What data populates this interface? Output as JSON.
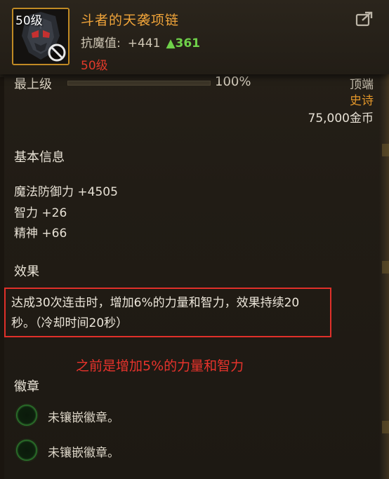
{
  "header": {
    "level_badge": "50级",
    "item_name": "斗者的天袭项链",
    "stat_label": "抗魔值:",
    "stat_value": "+441",
    "stat_up_arrow": "▲",
    "stat_up_value": "361",
    "required_level": "50级",
    "icons": {
      "item": "necklace-item-icon",
      "ban": "ban-icon",
      "share": "share-link-icon"
    }
  },
  "partial_row": {
    "label": "最上级",
    "percent": "100%",
    "right_text": "顶端"
  },
  "rarity": "史诗",
  "price": "75,000金币",
  "basic_info": {
    "title": "基本信息",
    "stats": [
      "魔法防御力 +4505",
      "智力 +26",
      "精神 +66"
    ]
  },
  "effect": {
    "title": "效果",
    "line1": "达成30次连击时，增加6%的力量和智力，效果持续20",
    "line2": "秒。（冷却时间20秒）"
  },
  "annotation": "之前是增加5%的力量和智力",
  "emblems": {
    "title": "徽章",
    "slots": [
      "未镶嵌徽章。",
      "未镶嵌徽章。"
    ]
  },
  "colors": {
    "item_name": "#f0a43a",
    "required_level": "#e23a2a",
    "stat_increase": "#6fd14a",
    "rarity_epic": "#e2962a",
    "highlight_box": "#e0302a",
    "annotation": "#e8332c",
    "icon_frame": "#c08a24"
  }
}
